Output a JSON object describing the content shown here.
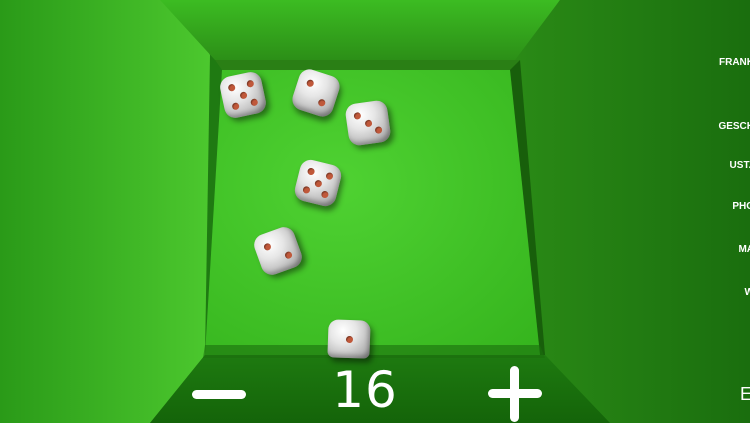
{
  "game": {
    "dice_count": "16",
    "minus_label": "minus-icon",
    "plus_label": "plus-icon"
  },
  "dice": [
    {
      "face": 5
    },
    {
      "face": 2
    },
    {
      "face": 3
    },
    {
      "face": 5
    },
    {
      "face": 2
    },
    {
      "face": 1
    }
  ],
  "info_panel": {
    "lines": [
      "FRANK",
      "GESCH",
      "UST.I",
      "PHO",
      "MA",
      "W",
      "E"
    ]
  },
  "colors": {
    "felt": "#43c628",
    "wall_dark": "#1d7d10",
    "wall_light": "#3fb024",
    "pip": "#c0583a",
    "text": "#ffffff"
  }
}
